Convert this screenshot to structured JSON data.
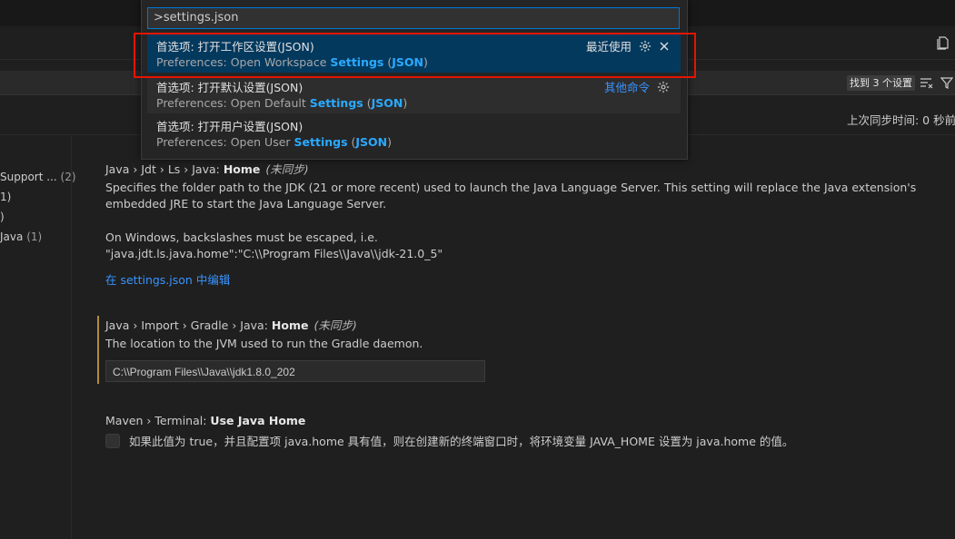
{
  "quickpick": {
    "input_value": ">settings.json",
    "items": [
      {
        "label": "首选项: 打开工作区设置(JSON)",
        "detail_prefix": "Preferences: Open Workspace ",
        "detail_hl1": "Settings",
        "detail_mid": " (",
        "detail_hl2": "JSON",
        "detail_end": ")",
        "right_text": "最近使用"
      },
      {
        "label": "首选项: 打开默认设置(JSON)",
        "detail_prefix": "Preferences: Open Default ",
        "detail_hl1": "Settings",
        "detail_mid": " (",
        "detail_hl2": "JSON",
        "detail_end": ")",
        "right_text": "其他命令"
      },
      {
        "label": "首选项: 打开用户设置(JSON)",
        "detail_prefix": "Preferences: Open User ",
        "detail_hl1": "Settings",
        "detail_mid": " (",
        "detail_hl2": "JSON",
        "detail_end": ")"
      }
    ]
  },
  "search": {
    "count": "找到 3 个设置"
  },
  "sync": {
    "text": "上次同步时间: 0 秒前"
  },
  "toc": [
    {
      "label": "Support ...",
      "count": "(2)"
    },
    {
      "label": "1)",
      "count": ""
    },
    {
      "label": ")",
      "count": ""
    },
    {
      "label": "Java",
      "count": "(1)"
    }
  ],
  "settings": [
    {
      "path": "Java › Jdt › Ls › Java: ",
      "name": "Home",
      "status": "(未同步)",
      "desc1": "Specifies the folder path to the JDK (21 or more recent) used to launch the Java Language Server. This setting will replace the Java extension's embedded JRE to start the Java Language Server.",
      "desc2": "On Windows, backslashes must be escaped, i.e.",
      "desc3": "\"java.jdt.ls.java.home\":\"C:\\\\Program Files\\\\Java\\\\jdk-21.0_5\"",
      "link": "在 settings.json 中编辑"
    },
    {
      "path": "Java › Import › Gradle › Java: ",
      "name": "Home",
      "status": "(未同步)",
      "desc1": "The location to the JVM used to run the Gradle daemon.",
      "value": "C:\\\\Program Files\\\\Java\\\\jdk1.8.0_202"
    },
    {
      "path": "Maven › Terminal: ",
      "name": "Use Java Home",
      "desc1": "如果此值为 true，并且配置项 java.home 具有值，则在创建新的终端窗口时，将环境变量 JAVA_HOME 设置为 java.home 的值。"
    }
  ],
  "icons": {
    "gear": "gear-icon",
    "close": "close-icon",
    "filter": "filter-icon",
    "clear": "clear-filter-icon",
    "open_json": "open-json-icon"
  },
  "colors": {
    "accent": "#0078d4",
    "selection": "#04395e",
    "highlight": "#2aaaff",
    "link": "#3794ff",
    "annotation_box": "#e51400"
  }
}
